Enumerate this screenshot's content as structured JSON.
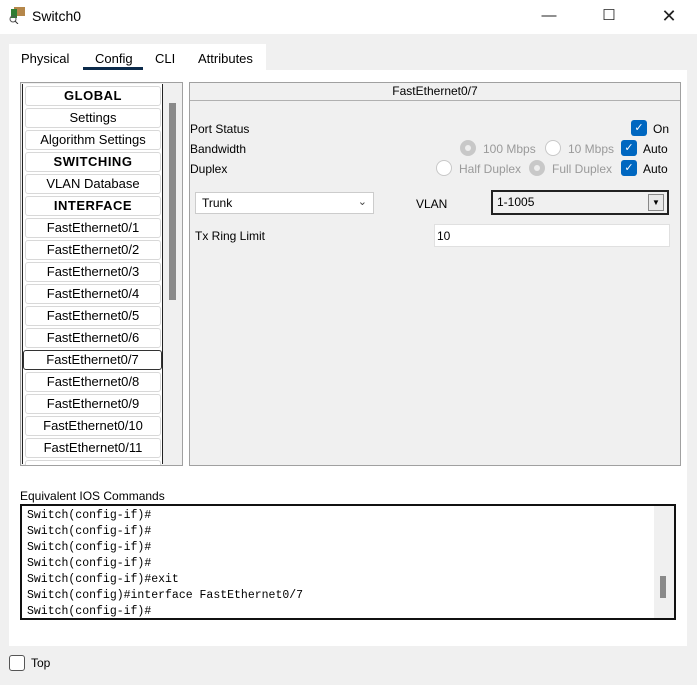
{
  "window": {
    "title": "Switch0",
    "controls": [
      "minimize",
      "maximize",
      "close"
    ]
  },
  "tabs": [
    {
      "label": "Physical"
    },
    {
      "label": "Config",
      "active": true
    },
    {
      "label": "CLI"
    },
    {
      "label": "Attributes"
    }
  ],
  "sidebar": {
    "items": [
      {
        "label": "GLOBAL",
        "header": true
      },
      {
        "label": "Settings"
      },
      {
        "label": "Algorithm Settings"
      },
      {
        "label": "SWITCHING",
        "header": true
      },
      {
        "label": "VLAN Database"
      },
      {
        "label": "INTERFACE",
        "header": true
      },
      {
        "label": "FastEthernet0/1"
      },
      {
        "label": "FastEthernet0/2"
      },
      {
        "label": "FastEthernet0/3"
      },
      {
        "label": "FastEthernet0/4"
      },
      {
        "label": "FastEthernet0/5"
      },
      {
        "label": "FastEthernet0/6"
      },
      {
        "label": "FastEthernet0/7",
        "selected": true
      },
      {
        "label": "FastEthernet0/8"
      },
      {
        "label": "FastEthernet0/9"
      },
      {
        "label": "FastEthernet0/10"
      },
      {
        "label": "FastEthernet0/11"
      }
    ]
  },
  "panel": {
    "title": "FastEthernet0/7",
    "port_status": {
      "label": "Port Status",
      "on_label": "On",
      "on": true
    },
    "bandwidth": {
      "label": "Bandwidth",
      "opt1": "100 Mbps",
      "opt2": "10 Mbps",
      "auto_label": "Auto",
      "auto": true
    },
    "duplex": {
      "label": "Duplex",
      "opt1": "Half Duplex",
      "opt2": "Full Duplex",
      "auto_label": "Auto",
      "auto": true
    },
    "mode": {
      "value": "Trunk"
    },
    "vlan": {
      "label": "VLAN",
      "value": "1-1005"
    },
    "tx_ring": {
      "label": "Tx Ring Limit",
      "value": "10"
    }
  },
  "ios": {
    "label": "Equivalent IOS Commands",
    "lines": "Switch(config-if)#\nSwitch(config-if)#\nSwitch(config-if)#\nSwitch(config-if)#\nSwitch(config-if)#exit\nSwitch(config)#interface FastEthernet0/7\nSwitch(config-if)#"
  },
  "footer": {
    "top_label": "Top",
    "top_checked": false
  },
  "colors": {
    "accent": "#0067c0",
    "tab_underline": "#0b2a4a"
  }
}
